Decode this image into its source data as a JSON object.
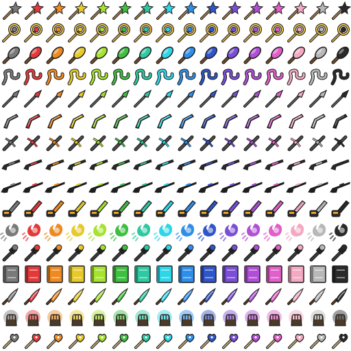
{
  "sheet": {
    "background": "#ffffff",
    "columns": 16,
    "rows": 16,
    "variant_colors": [
      "#7a7a7a",
      "#e23a3a",
      "#ee8a22",
      "#e6c92a",
      "#a6e22e",
      "#3fbf3f",
      "#2ec9a0",
      "#2fd6e8",
      "#2f8fe8",
      "#2f55c9",
      "#7a4fd6",
      "#b04fd6",
      "#e05fc8",
      "#f3a9c2",
      "#b8b8b8",
      "#2a2a2a"
    ],
    "row_items": [
      {
        "icon": "star-wand-icon"
      },
      {
        "icon": "crescent-staff-icon"
      },
      {
        "icon": "club-icon"
      },
      {
        "icon": "chain-whip-icon"
      },
      {
        "icon": "spear-icon"
      },
      {
        "icon": "boomerang-icon"
      },
      {
        "icon": "crossbow-icon"
      },
      {
        "icon": "shotgun-icon"
      },
      {
        "icon": "rifle-icon"
      },
      {
        "icon": "chainsaw-icon"
      },
      {
        "icon": "fireball-icon"
      },
      {
        "icon": "magic-staff-icon"
      },
      {
        "icon": "spellbook-icon"
      },
      {
        "icon": "flame-dagger-icon"
      },
      {
        "icon": "glowing-gauntlet-icon"
      },
      {
        "icon": "heart-key-icon"
      }
    ]
  }
}
